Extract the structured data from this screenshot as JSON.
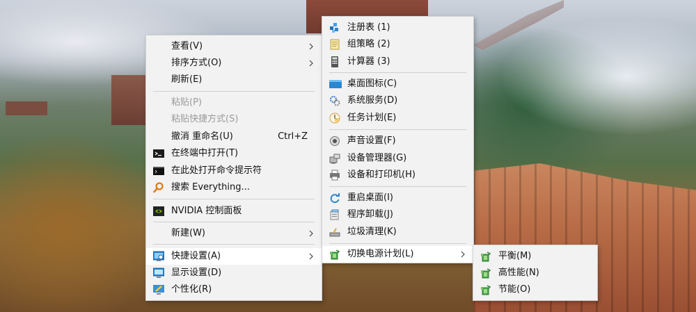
{
  "main_menu": {
    "items": [
      {
        "label": "查看(V)"
      },
      {
        "label": "排序方式(O)"
      },
      {
        "label": "刷新(E)"
      },
      {
        "label": "粘贴(P)"
      },
      {
        "label": "粘贴快捷方式(S)"
      },
      {
        "label": "撤消 重命名(U)",
        "shortcut": "Ctrl+Z"
      },
      {
        "label": "在终端中打开(T)"
      },
      {
        "label": "在此处打开命令提示符"
      },
      {
        "label": "搜索 Everything..."
      },
      {
        "label": "NVIDIA 控制面板"
      },
      {
        "label": "新建(W)"
      },
      {
        "label": "快捷设置(A)"
      },
      {
        "label": "显示设置(D)"
      },
      {
        "label": "个性化(R)"
      }
    ]
  },
  "quick_settings_menu": {
    "items": [
      {
        "label": "注册表  (1)"
      },
      {
        "label": "组策略  (2)"
      },
      {
        "label": "计算器  (3)"
      },
      {
        "label": "桌面图标(C)"
      },
      {
        "label": "系统服务(D)"
      },
      {
        "label": "任务计划(E)"
      },
      {
        "label": "声音设置(F)"
      },
      {
        "label": "设备管理器(G)"
      },
      {
        "label": "设备和打印机(H)"
      },
      {
        "label": "重启桌面(I)"
      },
      {
        "label": "程序卸载(J)"
      },
      {
        "label": "垃圾清理(K)"
      },
      {
        "label": "切换电源计划(L)"
      }
    ]
  },
  "power_plan_menu": {
    "items": [
      {
        "label": "平衡(M)"
      },
      {
        "label": "高性能(N)"
      },
      {
        "label": "节能(O)"
      }
    ]
  },
  "colors": {
    "menu_bg": "#f2f2f2",
    "highlight": "#ffffff",
    "disabled_text": "#9a9a9a"
  }
}
